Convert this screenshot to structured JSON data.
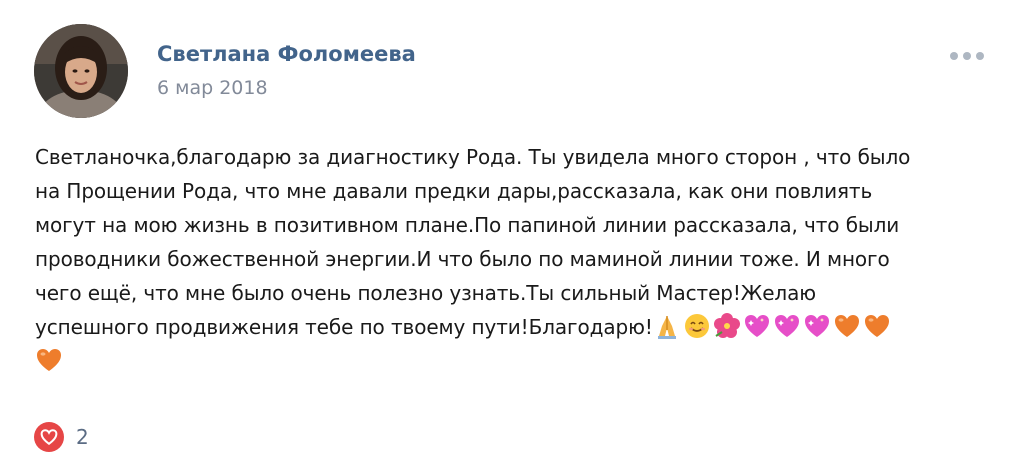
{
  "author": {
    "name": "Светлана Фоломеева",
    "date": "6 мар 2018"
  },
  "post": {
    "lines": [
      "Светланочка,благодарю за диагностику Рода. Ты увидела много сторон , что было",
      "на Прощении Рода, что мне давали предки дары,рассказала, как они повлиять",
      "могут на мою жизнь в позитивном плане.По папиной линии рассказала, что были",
      "проводники божественной энергии.И что было по маминой линии тоже. И много",
      "чего ещё, что мне было очень полезно узнать.Ты сильный Мастер!Желаю",
      "успешного продвижения тебе по твоему пути!Благодарю!"
    ],
    "emojis": [
      "folded-hands-icon",
      "smiling-face-icon",
      "hibiscus-icon",
      "sparkling-heart-icon",
      "sparkling-heart-icon",
      "sparkling-heart-icon",
      "orange-heart-icon",
      "orange-heart-icon",
      "orange-heart-icon"
    ]
  },
  "likes": {
    "count": "2",
    "icon": "heart-icon",
    "color": "#e64646"
  },
  "colors": {
    "name": "#42648b",
    "date": "#828a99",
    "text": "#1a1a1a"
  }
}
